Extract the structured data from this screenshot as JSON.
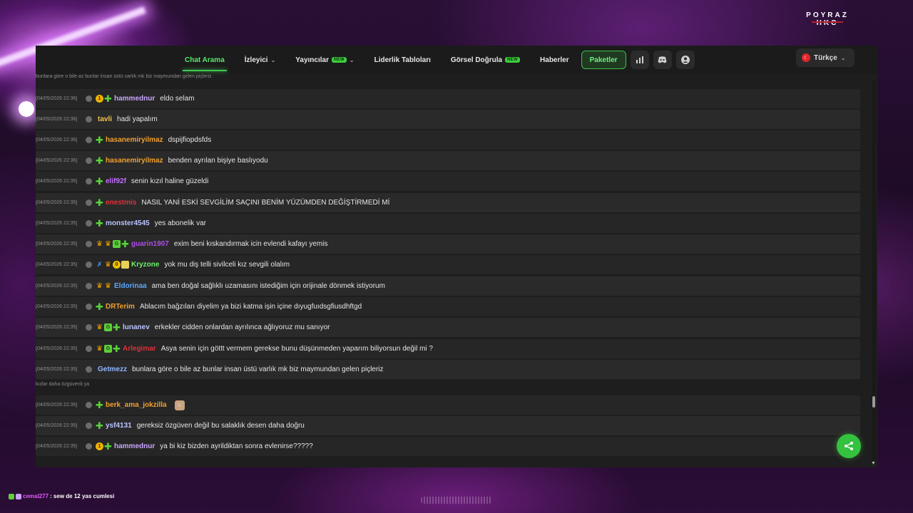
{
  "stream": {
    "brand": "POYRAZ HKC",
    "overlay_chat": {
      "user": "cemal277",
      "message": ": sew de 12 yas cumlesi"
    }
  },
  "nav": {
    "items": [
      {
        "label": "Chat Arama",
        "active": true
      },
      {
        "label": "İzleyici",
        "dropdown": true
      },
      {
        "label": "Yayıncılar",
        "badge": "NEW",
        "dropdown": true
      },
      {
        "label": "Liderlik Tabloları"
      },
      {
        "label": "Görsel Doğrula",
        "badge": "NEW"
      },
      {
        "label": "Haberler"
      },
      {
        "label": "Paketler",
        "highlight": true
      }
    ],
    "icons": [
      "chart-icon",
      "discord-icon",
      "user-icon"
    ],
    "language": "Türkçe"
  },
  "reply_refs": {
    "top": "bunlara göre o bile az bunlar insan üstü varlık mk biz maymundan gelen piçleriz",
    "middle": "kızlar daha özgüvenli ya"
  },
  "messages": [
    {
      "time": "[04/05/2026 22:36]",
      "badges": [
        "one",
        "plus"
      ],
      "user": "hammednur",
      "color": "#c9a6ff",
      "text": "eldo selam"
    },
    {
      "time": "[04/05/2026 22:36]",
      "badges": [],
      "user": "tavli",
      "color": "#f0c24b",
      "text": "hadi yapalım"
    },
    {
      "time": "[04/05/2026 22:36]",
      "badges": [
        "plus"
      ],
      "user": "hasanemiryilmaz",
      "color": "#f0a030",
      "text": "dspijfiopdsfds"
    },
    {
      "time": "[04/05/2026 22:36]",
      "badges": [
        "plus"
      ],
      "user": "hasanemiryilmaz",
      "color": "#f0a030",
      "text": "benden ayrılan bişiye baslıyodu"
    },
    {
      "time": "[04/05/2026 22:35]",
      "badges": [
        "plus"
      ],
      "user": "elif92f",
      "color": "#c36cff",
      "text": "senin kızıl haline güzeldi"
    },
    {
      "time": "[04/05/2026 22:35]",
      "badges": [
        "plus"
      ],
      "user": "enestmis",
      "color": "#e0303a",
      "text": "NASIL YANİ ESKİ SEVGİLİM SAÇINI BENİM YÜZÜMDEN DEĞİŞTİRMEDİ Mİ"
    },
    {
      "time": "[04/05/2026 22:35]",
      "badges": [
        "plus"
      ],
      "user": "monster4545",
      "color": "#b9c4ff",
      "text": "yes abonelik var"
    },
    {
      "time": "[04/05/2026 22:35]",
      "badges": [
        "crown",
        "crown",
        "g",
        "plus"
      ],
      "user": "guarin1907",
      "color": "#b04ce8",
      "text": "exim beni kıskandırmak icin evlendi kafayı yemis"
    },
    {
      "time": "[04/05/2026 22:35]",
      "badges": [
        "x",
        "m",
        "o",
        "box"
      ],
      "user": "Kryzone",
      "color": "#6bf06b",
      "text": "yok mu diş telli sivilceli kız sevgili olalım"
    },
    {
      "time": "[04/05/2026 22:35]",
      "badges": [
        "crown",
        "crown"
      ],
      "user": "Eldorinaa",
      "color": "#5aa8ff",
      "text": "ama ben doğal sağlıklı uzamasını istediğim için orijinale dönmek istiyorum"
    },
    {
      "time": "[04/05/2026 22:35]",
      "badges": [
        "plus"
      ],
      "user": "DRTerim",
      "color": "#f0a030",
      "text": "Ablacım bağzıları diyelim ya bizi katma işin içine dıyugfuıdsgfiusdhftgd"
    },
    {
      "time": "[04/05/2026 22:35]",
      "badges": [
        "crown",
        "g",
        "plus"
      ],
      "user": "lunanev",
      "color": "#b9c4ff",
      "text": "erkekler cidden onlardan ayrılınca ağlıyoruz mu sanıyor"
    },
    {
      "time": "[04/05/2026 22:35]",
      "badges": [
        "crown",
        "g",
        "plus"
      ],
      "user": "Arlegimar",
      "color": "#e0303a",
      "text": "Asya senin için göttt vermem gerekse bunu düşünmeden yaparım biliyorsun değil mi ?"
    },
    {
      "time": "[04/05/2026 22:35]",
      "badges": [],
      "user": "Getmezz",
      "color": "#8fb5ff",
      "text": "bunlara göre o bile az bunlar insan üstü varlık mk biz maymundan gelen piçleriz"
    },
    {
      "time": "[04/05/2026 22:35]",
      "badges": [
        "plus"
      ],
      "user": "berk_ama_jokzilla",
      "color": "#f0a030",
      "text": "",
      "emote": true
    },
    {
      "time": "[04/05/2026 22:35]",
      "badges": [
        "plus"
      ],
      "user": "ysf4131",
      "color": "#b9c4ff",
      "text": "gereksiz özgüven değil bu salaklık desen daha doğru"
    },
    {
      "time": "[04/05/2026 22:35]",
      "badges": [
        "one",
        "plus"
      ],
      "user": "hammednur",
      "color": "#c9a6ff",
      "text": "ya bi kiz bizden ayrildiktan sonra evlenirse?????"
    }
  ]
}
